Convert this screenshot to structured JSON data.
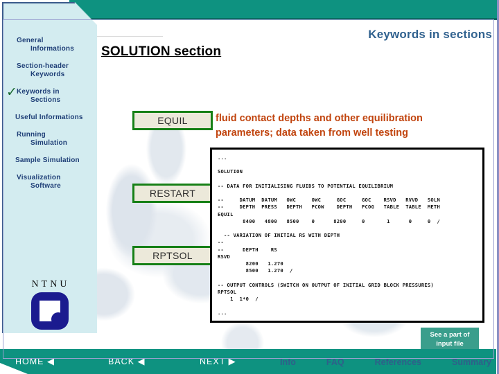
{
  "header": {
    "breadcrumb": "Keywords in sections",
    "slide_title": "SOLUTION section"
  },
  "sidebar": {
    "items": [
      {
        "line1": "General",
        "line2": "Informations",
        "checked": false
      },
      {
        "line1": "Section-header",
        "line2": "Keywords",
        "checked": false
      },
      {
        "line1": "Keywords in",
        "line2": "Sections",
        "checked": true
      },
      {
        "line1": "Useful Informations",
        "line2": "",
        "checked": false
      },
      {
        "line1": "Running",
        "line2": "Simulation",
        "checked": false
      },
      {
        "line1": "Sample Simulation",
        "line2": "",
        "checked": false
      },
      {
        "line1": "Visualization",
        "line2": "Software",
        "checked": false
      }
    ],
    "check_glyph": "✓"
  },
  "keywords": [
    {
      "label": "EQUIL"
    },
    {
      "label": "RESTART"
    },
    {
      "label": "RPTSOL"
    }
  ],
  "description": "fluid contact depths and other equilibration parameters; data taken from well testing",
  "code_listing": "...\n\nSOLUTION\n\n-- DATA FOR INITIALISING FLUIDS TO POTENTIAL EQUILIBRIUM\n\n--     DATUM  DATUM   OWC     OWC     GOC     GOC    RSVD   RVVD   SOLN\n--     DEPTH  PRESS   DEPTH   PCOW    DEPTH   PCOG   TABLE  TABLE  METH\nEQUIL\n        8400   4800   8500    0      8200     0       1      0     0  /\n\n  -- VARIATION OF INITIAL RS WITH DEPTH\n--\n--      DEPTH    RS\nRSVD\n         8200   1.270\n         8500   1.270  /\n\n-- OUTPUT CONTROLS (SWITCH ON OUTPUT OF INITIAL GRID BLOCK PRESSURES)\nRPTSOL\n    1  1*0  /\n\n...",
  "callout": {
    "line1": "See a part of",
    "line2": "input file"
  },
  "logo": {
    "text": "NTNU"
  },
  "nav": {
    "home": "HOME",
    "home_arrow": "◀",
    "back": "BACK",
    "back_arrow": "◀",
    "next": "NEXT",
    "next_arrow": "▶"
  },
  "footer": {
    "links": [
      "Info",
      "FAQ",
      "References",
      "Summary"
    ]
  },
  "colors": {
    "teal": "#0e9280",
    "sidebar": "#d3ecf0",
    "sidebar_text": "#1f3f77",
    "accent_orange": "#c1440e",
    "button_border_green": "#168016",
    "header_blue": "#31628f",
    "callout_teal": "#3a9e8c",
    "logo_navy": "#1b1b8f"
  }
}
